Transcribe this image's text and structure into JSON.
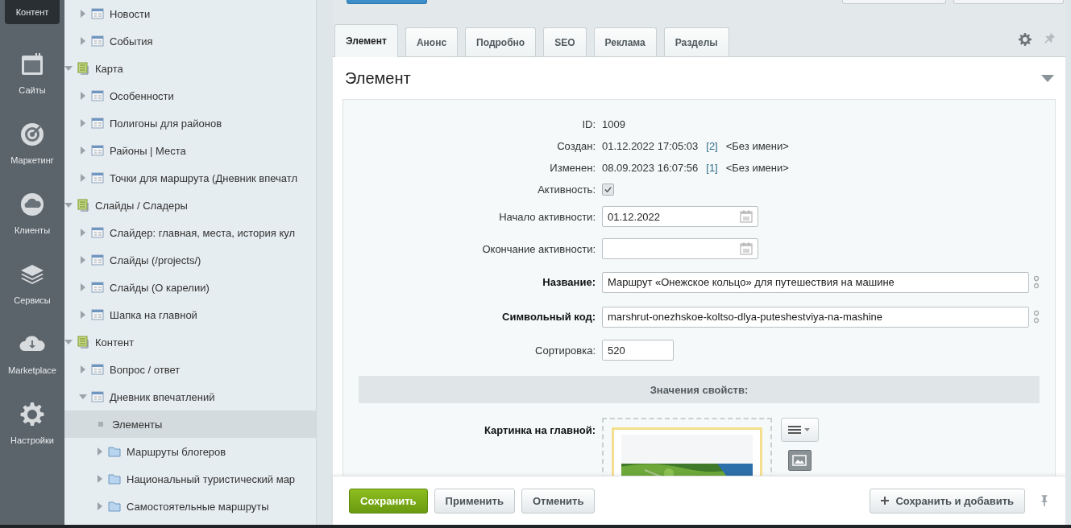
{
  "nav": [
    {
      "label": "Контент",
      "selected": true
    },
    {
      "label": "Сайты",
      "selected": false
    },
    {
      "label": "Маркетинг",
      "selected": false
    },
    {
      "label": "Клиенты",
      "selected": false
    },
    {
      "label": "Сервисы",
      "selected": false
    },
    {
      "label": "Marketplace",
      "selected": false
    },
    {
      "label": "Настройки",
      "selected": false
    }
  ],
  "tree": [
    {
      "children": [
        {
          "label": "Новости",
          "kind": "iblock",
          "expanded": false,
          "selected": false
        },
        {
          "label": "События",
          "kind": "iblock",
          "expanded": false,
          "selected": false
        }
      ]
    },
    {
      "label": "Карта",
      "kind": "type",
      "expanded": true,
      "selected": false,
      "children": [
        {
          "label": "Особенности",
          "kind": "iblock",
          "expanded": false,
          "selected": false
        },
        {
          "label": "Полигоны для районов",
          "kind": "iblock",
          "expanded": false,
          "selected": false
        },
        {
          "label": "Районы | Места",
          "kind": "iblock",
          "expanded": false,
          "selected": false
        },
        {
          "label": "Точки для маршрута (Дневник впечатл",
          "kind": "iblock",
          "expanded": false,
          "selected": false
        }
      ]
    },
    {
      "label": "Слайды / Сладеры",
      "kind": "type",
      "expanded": true,
      "selected": false,
      "children": [
        {
          "label": "Слайдер: главная, места, история кул",
          "kind": "iblock",
          "expanded": false,
          "selected": false
        },
        {
          "label": "Слайды (/projects/)",
          "kind": "iblock",
          "expanded": false,
          "selected": false
        },
        {
          "label": "Слайды (О карелии)",
          "kind": "iblock",
          "expanded": false,
          "selected": false
        },
        {
          "label": "Шапка на главной",
          "kind": "iblock",
          "expanded": false,
          "selected": false
        }
      ]
    },
    {
      "label": "Контент",
      "kind": "type",
      "expanded": true,
      "selected": false,
      "children": [
        {
          "label": "Вопрос / ответ",
          "kind": "iblock",
          "expanded": false,
          "selected": false
        },
        {
          "label": "Дневник впечатлений",
          "kind": "iblock",
          "expanded": true,
          "selected": false,
          "children": [
            {
              "label": "Элементы",
              "kind": "elements",
              "selected": true
            },
            {
              "label": "Маршруты блогеров",
              "kind": "section",
              "expanded": false,
              "selected": false
            },
            {
              "label": "Национальный туристический мар",
              "kind": "section",
              "expanded": false,
              "selected": false
            },
            {
              "label": "Самостоятельные маршруты",
              "kind": "section",
              "expanded": false,
              "selected": false
            }
          ]
        }
      ]
    }
  ],
  "tabs": [
    {
      "label": "Элемент",
      "selected": true
    },
    {
      "label": "Анонс",
      "selected": false
    },
    {
      "label": "Подробно",
      "selected": false
    },
    {
      "label": "SEO",
      "selected": false
    },
    {
      "label": "Реклама",
      "selected": false
    },
    {
      "label": "Разделы",
      "selected": false
    }
  ],
  "panel": {
    "title": "Элемент"
  },
  "fields": [
    {
      "kind": "text",
      "label": "ID:",
      "value": "1009"
    },
    {
      "kind": "stamp",
      "label": "Создан:",
      "value": "01.12.2022 17:05:03",
      "user_link": "[2]",
      "user_name": "<Без имени>"
    },
    {
      "kind": "stamp",
      "label": "Изменен:",
      "value": "08.09.2023 16:07:56",
      "user_link": "[1]",
      "user_name": "<Без имени>"
    },
    {
      "kind": "checkbox",
      "label": "Активность:",
      "checked": true
    },
    {
      "kind": "date",
      "label": "Начало активности:",
      "value": "01.12.2022"
    },
    {
      "kind": "date",
      "label": "Окончание активности:"
    },
    {
      "kind": "wide",
      "label": "Название:",
      "value": "Маршрут «Онежское кольцо» для путешествия на машине",
      "required": true
    },
    {
      "kind": "wide",
      "label": "Символьный код:",
      "value": "marshrut-onezhskoe-koltso-dlya-puteshestviya-na-mashine",
      "required": true
    },
    {
      "kind": "short",
      "label": "Сортировка:",
      "value": "520"
    }
  ],
  "properties": {
    "title": "Значения свойств:",
    "image_field": {
      "label": "Картинка на главной:",
      "kind": "picture"
    }
  },
  "footer": {
    "buttons": [
      {
        "label": "Сохранить",
        "kind": "primary"
      },
      {
        "label": "Применить",
        "kind": "plain"
      },
      {
        "label": "Отменить",
        "kind": "plain"
      }
    ],
    "add_button": {
      "label": "Сохранить и добавить"
    }
  }
}
